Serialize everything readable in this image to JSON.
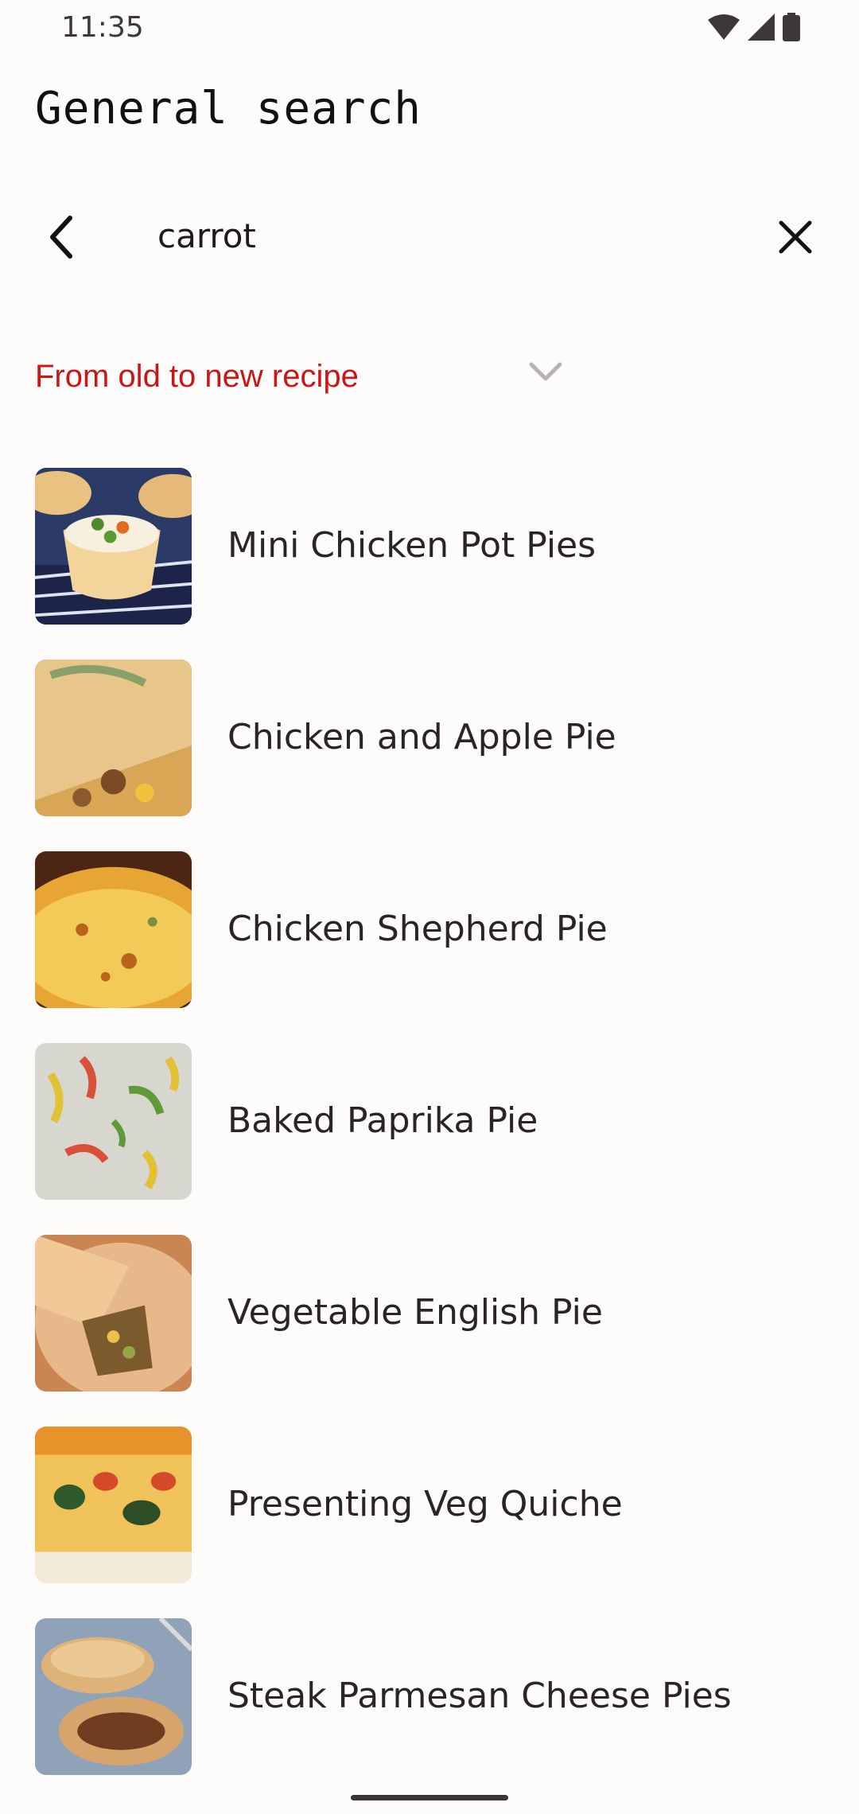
{
  "status_bar": {
    "time": "11:35",
    "icons": [
      "wifi-icon",
      "signal-icon",
      "battery-icon"
    ]
  },
  "page": {
    "title": "General search"
  },
  "search": {
    "value": "carrot",
    "back_icon": "arrow-back-icon",
    "clear_icon": "close-icon"
  },
  "sort": {
    "selected": "From old to new recipe",
    "accent_color": "#cc1616"
  },
  "recipes": [
    {
      "name": "Mini Chicken Pot Pies"
    },
    {
      "name": "Chicken and Apple Pie"
    },
    {
      "name": "Chicken Shepherd Pie"
    },
    {
      "name": "Baked Paprika Pie"
    },
    {
      "name": "Vegetable English Pie"
    },
    {
      "name": "Presenting Veg Quiche"
    },
    {
      "name": "Steak Parmesan Cheese Pies"
    }
  ]
}
